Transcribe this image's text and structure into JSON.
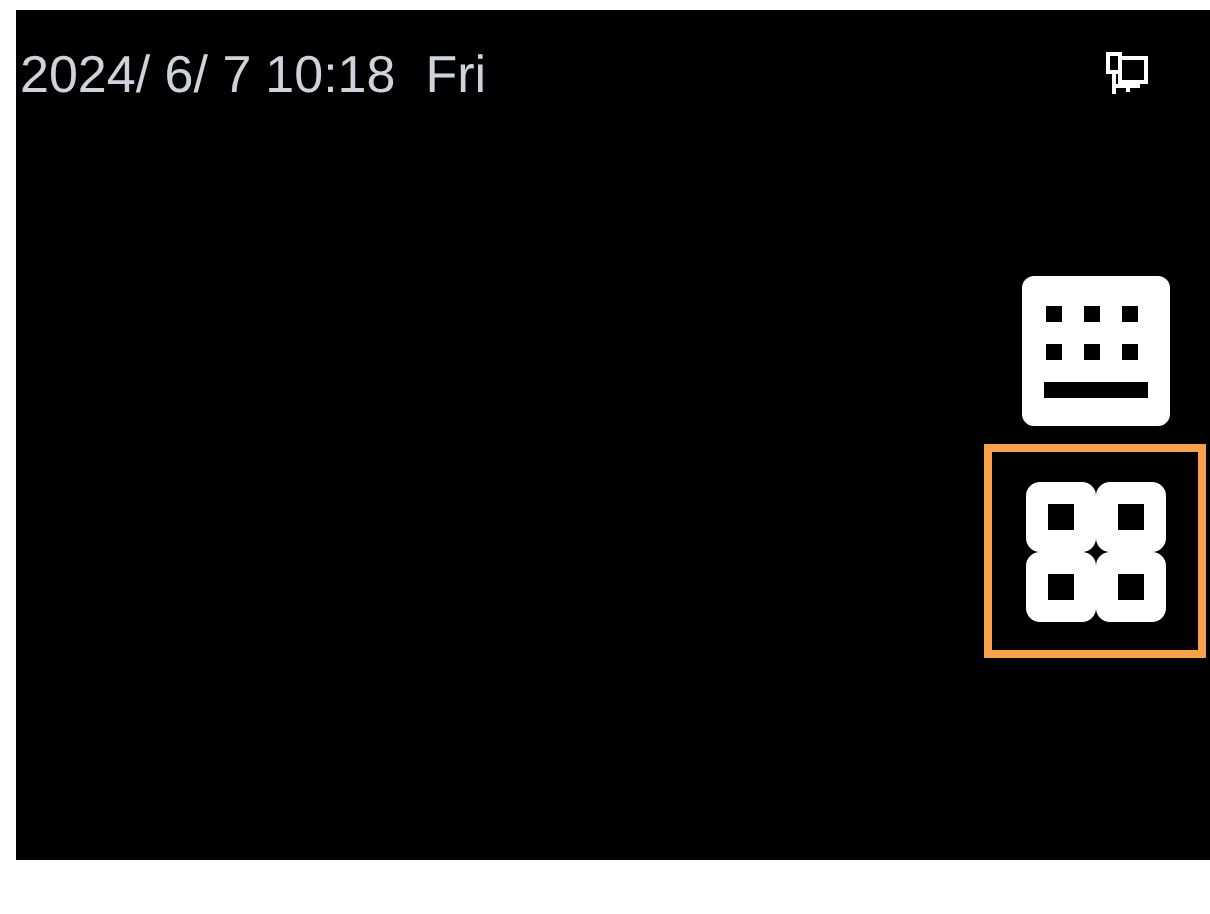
{
  "status_bar": {
    "date": "2024/ 6/ 7",
    "time": "10:18",
    "weekday": "Fri"
  },
  "buttons": [
    {
      "kind": "keyboard",
      "selected": false
    },
    {
      "kind": "apps",
      "selected": true
    }
  ]
}
